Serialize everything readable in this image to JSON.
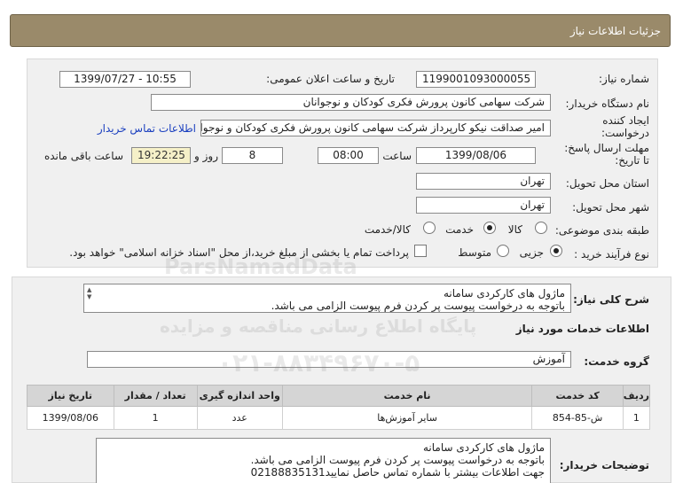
{
  "header": {
    "title": "جزئیات اطلاعات نیاز"
  },
  "form": {
    "need_number_label": "شماره نیاز:",
    "need_number": "1199001093000055",
    "announce_label": "تاریخ و ساعت اعلان عمومی:",
    "announce_value": "1399/07/27 - 10:55",
    "buyer_org_label": "نام دستگاه خریدار:",
    "buyer_org": "شرکت سهامی کانون پرورش فکری کودکان و نوجوانان",
    "creator_label_1": "ایجاد کننده",
    "creator_label_2": "درخواست:",
    "creator": "امیر صداقت نیکو کارپرداز شرکت سهامی کانون پرورش فکری کودکان و نوجوانان",
    "contact_link": "اطلاعات تماس خریدار",
    "deadline_label_1": "مهلت ارسال پاسخ:",
    "deadline_label_2": "تا تاریخ:",
    "deadline_date": "1399/08/06",
    "time_label": "ساعت",
    "deadline_time": "08:00",
    "days_value": "8",
    "days_label": "روز و",
    "time_left": "19:22:25",
    "time_left_label": "ساعت باقی مانده",
    "province_label": "استان محل تحویل:",
    "province": "تهران",
    "city_label": "شهر محل تحویل:",
    "city": "تهران",
    "category_label": "طبقه بندی موضوعی:",
    "category_options": [
      "کالا",
      "خدمت",
      "کالا/خدمت"
    ],
    "category_selected": "خدمت",
    "process_label": "نوع فرآیند خرید :",
    "process_options": [
      "جزیی",
      "متوسط"
    ],
    "process_selected": "جزیی",
    "payment_note": "پرداخت تمام یا بخشی از مبلغ خرید،از محل \"اسناد خزانه اسلامی\" خواهد بود."
  },
  "summary": {
    "label": "شرح کلی نیاز:",
    "lines": [
      "ماژول های کارکردی سامانه",
      "باتوجه به درخواست پیوست پر کردن فرم پیوست الزامی می باشد."
    ]
  },
  "services": {
    "section_title": "اطلاعات خدمات مورد نیاز",
    "group_label": "گروه خدمت:",
    "group_value": "آموزش",
    "columns": [
      "ردیف",
      "کد خدمت",
      "نام خدمت",
      "واحد اندازه گیری",
      "تعداد / مقدار",
      "تاریخ نیاز"
    ],
    "rows": [
      [
        "1",
        "ش-85-854",
        "سایر آموزش‌ها",
        "عدد",
        "1",
        "1399/08/06"
      ]
    ]
  },
  "buyer_notes": {
    "label": "توضیحات خریدار:",
    "lines": [
      "ماژول های کارکردی سامانه",
      "باتوجه به درخواست پیوست پر کردن فرم پیوست الزامی می باشد.",
      "جهت اطلاعات بیشتر  با شماره تماس حاصل نمایید02188835131"
    ]
  },
  "watermark": {
    "brand": "ParsNamadData",
    "line1": "پایگاه اطلاع رسانی مناقصه و مزایده",
    "line2": "۰۲۱-۸۸۳۴۹۶۷۰-۵"
  }
}
